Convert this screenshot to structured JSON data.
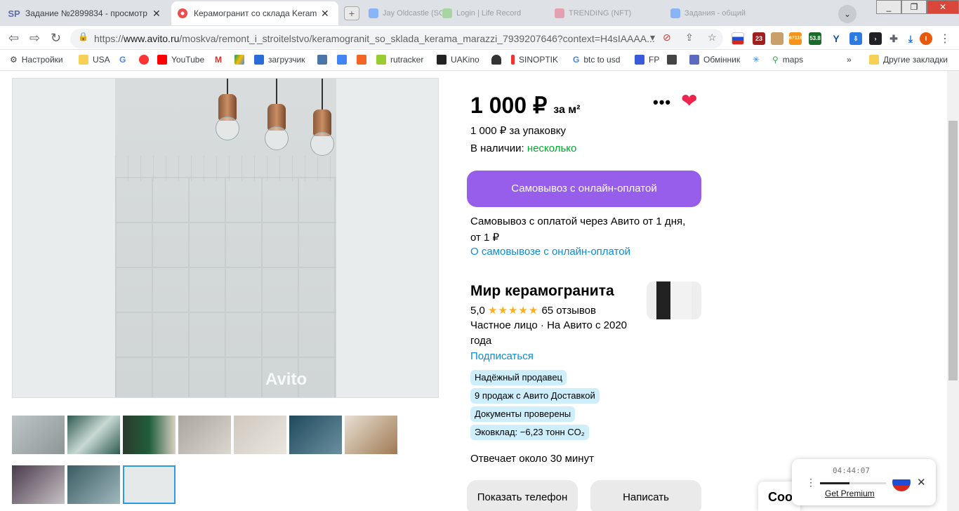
{
  "tabs": [
    {
      "title": "Задание №2899834 - просмотр з",
      "icon": "SP",
      "active": false
    },
    {
      "title": "Керамогранит со склада Kerama",
      "icon": "avito-icon",
      "active": true
    }
  ],
  "background_tabs": [
    "Jay Oldcastle (SC)",
    "Login | Life Record",
    "TRENDING (NFT)",
    "Задания - общий"
  ],
  "address": {
    "url_prefix": "https://",
    "domain": "www.avito.ru",
    "path": "/moskva/remont_i_stroitelstvo/keramogranit_so_sklada_kerama_marazzi_7939207646?context=H4sIAAAA..."
  },
  "extensions": {
    "ltc_label": "LTC",
    "ltc_value": "53.8",
    "badge_23": "23",
    "badge_btc": "67116",
    "profile_letter": "I"
  },
  "bookmarks": [
    {
      "label": "Настройки"
    },
    {
      "label": "USA"
    },
    {
      "label": ""
    },
    {
      "label": ""
    },
    {
      "label": "YouTube"
    },
    {
      "label": ""
    },
    {
      "label": ""
    },
    {
      "label": "загрузчик"
    },
    {
      "label": ""
    },
    {
      "label": ""
    },
    {
      "label": ""
    },
    {
      "label": "rutracker"
    },
    {
      "label": "UAKino"
    },
    {
      "label": ""
    },
    {
      "label": "SINOPTIK"
    },
    {
      "label": "btc to usd"
    },
    {
      "label": "FP"
    },
    {
      "label": ""
    },
    {
      "label": "Обмінник"
    },
    {
      "label": ""
    },
    {
      "label": "maps"
    }
  ],
  "bookmarks_overflow": "»",
  "other_bookmarks": "Другие закладки",
  "listing": {
    "watermark": "Avito",
    "price": "1 000 ₽",
    "price_unit": "за м²",
    "pack_price": "1 000 ₽ за упаковку",
    "availability_label": "В наличии:",
    "availability_value": "несколько",
    "buy_button": "Самовывоз с онлайн-оплатой",
    "pickup_text_1": "Самовывоз с оплатой через Авито от 1 дня,",
    "pickup_text_2": "от 1 ₽",
    "pickup_link": "О самовывозе с онлайн-оплатой",
    "more_button": "•••"
  },
  "seller": {
    "name": "Мир керамогранита",
    "rating": "5,0",
    "stars": "★★★★★",
    "reviews": "65 отзывов",
    "type_line_1": "Частное лицо · На Авито с 2020",
    "type_line_2": "года",
    "subscribe": "Подписаться",
    "badges": [
      "Надёжный продавец",
      "9 продаж с Авито Доставкой",
      "Документы проверены",
      "Эковклад: −6,23 тонн CO₂"
    ],
    "response_time": "Отвечает около 30 минут"
  },
  "actions": {
    "show_phone": "Показать телефон",
    "write": "Написать"
  },
  "widget": {
    "time": "04:44:07",
    "premium": "Get Premium",
    "progress": 0.45
  },
  "cookie_text": "Coo",
  "colors": {
    "accent_purple": "#965eeb",
    "heart_red": "#ef234c",
    "green": "#02a82f",
    "link_blue": "#0a8dd8",
    "badge_bg": "#cfeefc"
  }
}
